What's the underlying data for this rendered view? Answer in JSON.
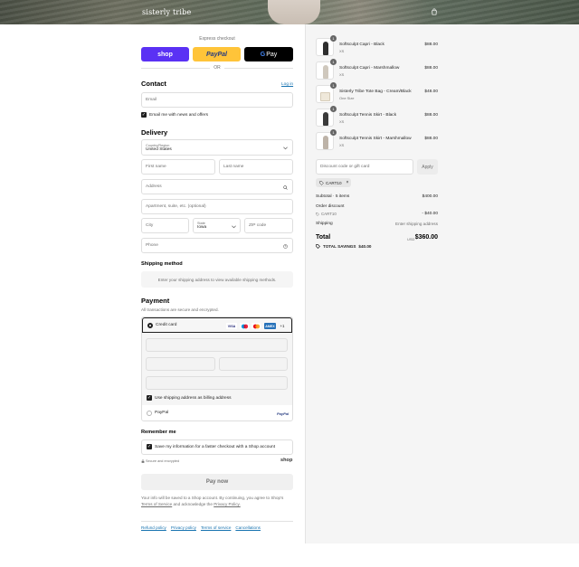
{
  "header": {
    "brand": "sisterly tribe"
  },
  "express": {
    "label": "Express checkout",
    "shop": "shop",
    "paypal": "PayPal",
    "gpay_g": "G",
    "gpay": "Pay",
    "or": "OR"
  },
  "contact": {
    "title": "Contact",
    "login": "Log in",
    "email_placeholder": "Email",
    "news_label": "Email me with news and offers"
  },
  "delivery": {
    "title": "Delivery",
    "country_label": "Country/Region",
    "country_value": "United States",
    "first_name": "First name",
    "last_name": "Last name",
    "address": "Address",
    "apartment": "Apartment, suite, etc. (optional)",
    "city": "City",
    "state_label": "State",
    "state_value": "Iowa",
    "zip": "ZIP code",
    "phone": "Phone"
  },
  "shipping": {
    "title": "Shipping method",
    "message": "Enter your shipping address to view available shipping methods."
  },
  "payment": {
    "title": "Payment",
    "subtitle": "All transactions are secure and encrypted.",
    "credit_card": "Credit card",
    "brands": [
      "VISA",
      "MC",
      "MAE",
      "AMEX",
      "+1"
    ],
    "billing_label": "Use shipping address as billing address",
    "paypal_option": "PayPal",
    "paypal_logo": "PayPal"
  },
  "remember": {
    "title": "Remember me",
    "save_label": "Save my information for a faster checkout with a Shop account",
    "secure": "Secure and encrypted",
    "shop_logo": "shop"
  },
  "pay_now": "Pay now",
  "legal": {
    "line1": "Your info will be saved to a Shop account. By continuing, you agree to Shop's",
    "terms": "Terms of Service",
    "middle": "and acknowledge the",
    "privacy": "Privacy Policy."
  },
  "footer": {
    "links": [
      "Refund policy",
      "Privacy policy",
      "Terms of service",
      "Cancellations"
    ]
  },
  "cart": {
    "items": [
      {
        "name": "Softsculpt Capri - Black",
        "variant": "XS",
        "price": "$88.00",
        "qty": "1"
      },
      {
        "name": "Softsculpt Capri - Marshmallow",
        "variant": "XS",
        "price": "$88.00",
        "qty": "1"
      },
      {
        "name": "Sisterly Tribe Tote Bag - Cream/Black",
        "variant": "One Size",
        "price": "$48.00",
        "qty": "1"
      },
      {
        "name": "Softsculpt Tennis Skirt - Black",
        "variant": "XS",
        "price": "$88.00",
        "qty": "1"
      },
      {
        "name": "Softsculpt Tennis Skirt - Marshmallow",
        "variant": "XS",
        "price": "$88.00",
        "qty": "1"
      }
    ],
    "discount_placeholder": "Discount code or gift card",
    "apply": "Apply",
    "code_chip": "CART10",
    "subtotal_label": "Subtotal · 5 items",
    "subtotal_value": "$400.00",
    "order_discount": "Order discount",
    "discount_code": "CART10",
    "discount_value": "- $40.00",
    "shipping_label": "Shipping",
    "shipping_value": "Enter shipping address",
    "total_label": "Total",
    "currency": "USD",
    "total_value": "$360.00",
    "savings_label": "TOTAL SAVINGS",
    "savings_value": "$40.00"
  }
}
